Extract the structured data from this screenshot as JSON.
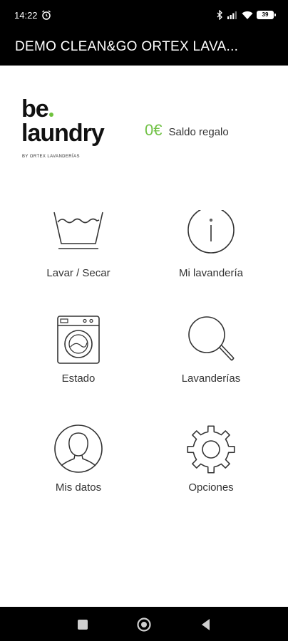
{
  "status_bar": {
    "time": "14:22",
    "battery": "39",
    "icons": [
      "alarm-icon",
      "bluetooth-icon",
      "signal-icon",
      "wifi-icon",
      "battery-icon"
    ]
  },
  "app_bar": {
    "title": "DEMO CLEAN&GO ORTEX LAVA..."
  },
  "brand": {
    "logo_line1": "be",
    "logo_line2": "laundry",
    "logo_tagline": "BY ORTEX LAVANDERÍAS",
    "accent_color": "#6fc23d"
  },
  "balance": {
    "amount": "0€",
    "label": "Saldo regalo",
    "color": "#72c247"
  },
  "menu": {
    "wash_label": "Lavar / Secar",
    "my_laundry_label": "Mi lavandería",
    "status_label": "Estado",
    "laundries_label": "Lavanderías",
    "my_data_label": "Mis datos",
    "options_label": "Opciones",
    "icons": [
      "wash-basin-icon",
      "info-icon",
      "washing-machine-icon",
      "search-icon",
      "user-icon",
      "gear-icon"
    ]
  },
  "nav_bar": {
    "icons": [
      "recents-square-icon",
      "home-circle-icon",
      "back-triangle-icon"
    ]
  }
}
